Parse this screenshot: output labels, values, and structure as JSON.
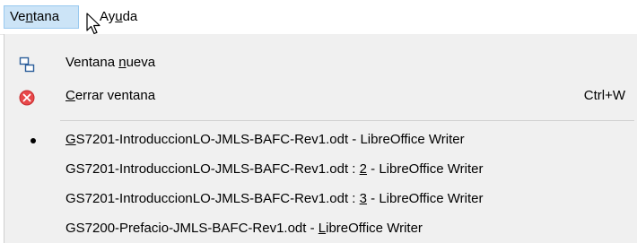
{
  "menubar": {
    "window_menu": {
      "pre": "Ve",
      "accel": "n",
      "post": "tana"
    },
    "help_menu": {
      "pre": "Ay",
      "accel": "u",
      "post": "da"
    }
  },
  "window_menu": {
    "items": [
      {
        "icon": "new-window-icon",
        "pre": "Ventana ",
        "accel": "n",
        "post": "ueva",
        "shortcut": ""
      },
      {
        "icon": "close-window-icon",
        "pre": "",
        "accel": "C",
        "post": "errar ventana",
        "shortcut": "Ctrl+W"
      }
    ],
    "documents": [
      {
        "pre": "",
        "accel": "G",
        "post": "S7201-IntroduccionLO-JMLS-BAFC-Rev1.odt - LibreOffice Writer",
        "active": true
      },
      {
        "pre": "GS7201-IntroduccionLO-JMLS-BAFC-Rev1.odt : ",
        "accel": "2",
        "post": " - LibreOffice Writer",
        "active": false
      },
      {
        "pre": "GS7201-IntroduccionLO-JMLS-BAFC-Rev1.odt : ",
        "accel": "3",
        "post": " - LibreOffice Writer",
        "active": false
      },
      {
        "pre": "GS7200-Prefacio-JMLS-BAFC-Rev1.odt - ",
        "accel": "L",
        "post": "ibreOffice Writer",
        "active": false
      }
    ]
  },
  "colors": {
    "menu_active_bg": "#cce4f7",
    "menu_active_border": "#99c9ef",
    "dropdown_bg": "#f0f0f0",
    "close_icon_red": "#e8484a",
    "new_window_icon_blue": "#2a5d9a"
  }
}
